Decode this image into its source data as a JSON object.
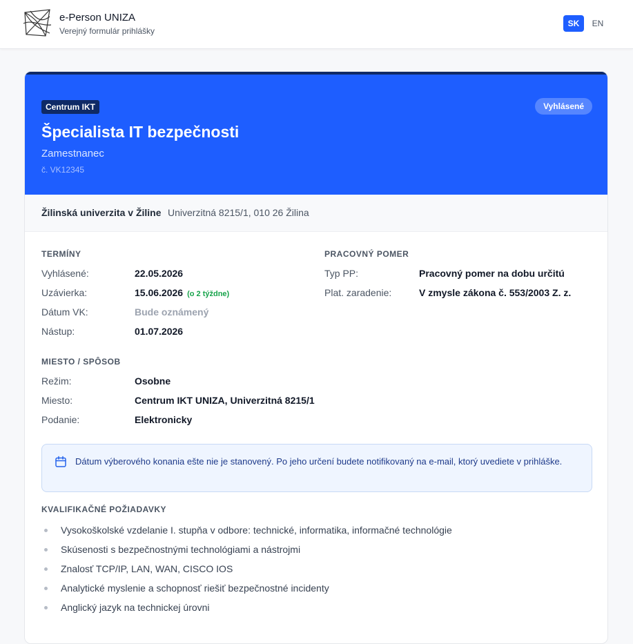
{
  "header": {
    "brand_title": "e-Person UNIZA",
    "brand_subtitle": "Verejný formulár prihlášky",
    "logo_icon": "uniza-logo-icon",
    "languages": [
      {
        "code": "SK",
        "active": true
      },
      {
        "code": "EN",
        "active": false
      }
    ]
  },
  "job": {
    "department": "Centrum IKT",
    "status": "Vyhlásené",
    "title": "Špecialista IT bezpečnosti",
    "type": "Zamestnanec",
    "number": "č. VK12345"
  },
  "organization": {
    "name": "Žilinská univerzita v Žiline",
    "separator": "·",
    "address": "Univerzitná 8215/1, 010 26 Žilina"
  },
  "terms": {
    "heading": "TERMÍNY",
    "rows": [
      {
        "label": "Vyhlásené:",
        "value": "22.05.2026"
      },
      {
        "label": "Uzávierka:",
        "value": "15.06.2026",
        "hint": "(o 2 týždne)"
      },
      {
        "label": "Dátum VK:",
        "value": "Bude oznámený"
      },
      {
        "label": "Nástup:",
        "value": "01.07.2026"
      }
    ]
  },
  "employment": {
    "heading": "PRACOVNÝ POMER",
    "rows": [
      {
        "label": "Typ PP:",
        "value": "Pracovný pomer na dobu určitú"
      },
      {
        "label": "Plat. zaradenie:",
        "value": "V zmysle zákona č. 553/2003 Z. z."
      }
    ]
  },
  "place": {
    "heading": "MIESTO / SPÔSOB",
    "rows": [
      {
        "label": "Režim:",
        "value": "Osobne"
      },
      {
        "label": "Miesto:",
        "value": "Centrum IKT UNIZA, Univerzitná 8215/1"
      },
      {
        "label": "Podanie:",
        "value": "Elektronicky"
      }
    ]
  },
  "notice": {
    "icon": "calendar-icon",
    "text": "Dátum výberového konania ešte nie je stanovený. Po jeho určení budete notifikovaný na e-mail, ktorý uvediete v prihláške."
  },
  "requirements": {
    "heading": "KVALIFIKAČNÉ POŽIADAVKY",
    "items": [
      "Vysokoškolské vzdelanie I. stupňa v odbore: technické, informatika, informačné technológie",
      "Skúsenosti s bezpečnostnými technológiami a nástrojmi",
      "Znalosť TCP/IP, LAN, WAN, CISCO IOS",
      "Analytické myslenie a schopnosť riešiť bezpečnostné incidenty",
      "Anglický jazyk na technickej úrovni"
    ]
  },
  "colors": {
    "primary": "#1e5eff",
    "navy": "#0f2a66",
    "success": "#16a34a",
    "notice_bg": "#eff5ff"
  }
}
